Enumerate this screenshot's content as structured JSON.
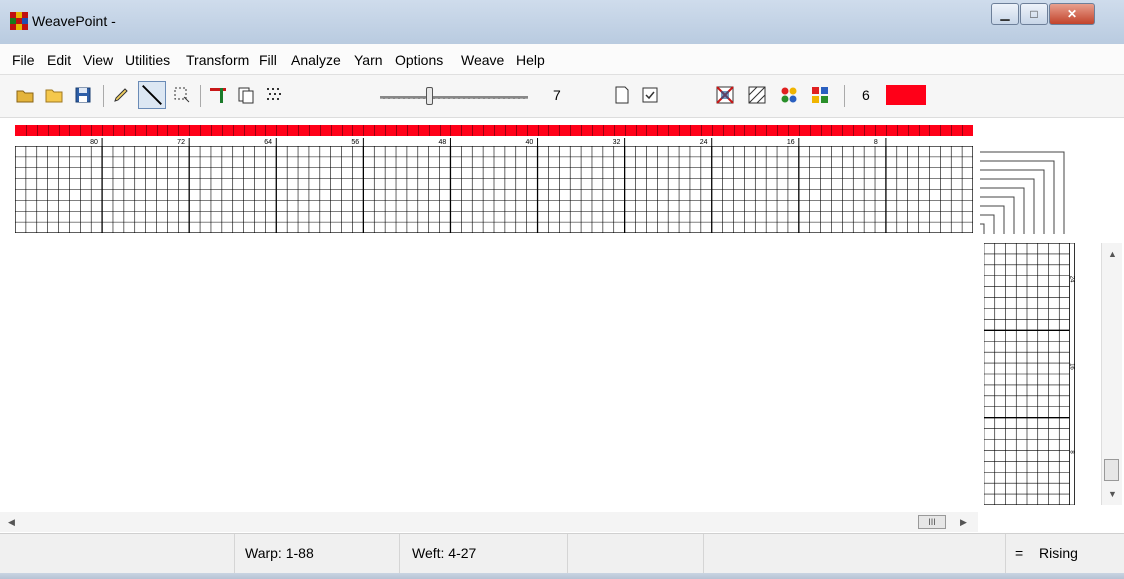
{
  "window": {
    "title": "WeavePoint -"
  },
  "menu": [
    "File",
    "Edit",
    "View",
    "Utilities",
    "Transform",
    "Fill",
    "Analyze",
    "Yarn",
    "Options",
    "Weave",
    "Help"
  ],
  "toolbar": {
    "slider_value": "7",
    "color_index": "6",
    "current_color": "#ff0018",
    "tools": [
      {
        "name": "open-icon"
      },
      {
        "name": "folder-icon"
      },
      {
        "name": "save-icon"
      },
      {
        "name": "pencil-tool-icon"
      },
      {
        "name": "line-tool-icon"
      },
      {
        "name": "select-tool-icon"
      },
      {
        "name": "threading-tool-icon"
      },
      {
        "name": "copy-icon"
      },
      {
        "name": "pattern-icon"
      },
      {
        "name": "new-page-icon"
      },
      {
        "name": "check-icon"
      },
      {
        "name": "weave-view-icon"
      },
      {
        "name": "drawdown-icon"
      },
      {
        "name": "yarn-colors-icon"
      },
      {
        "name": "palette-icon"
      }
    ]
  },
  "warp_ruler": {
    "labels": [
      "80",
      "72",
      "64",
      "56",
      "48",
      "40",
      "32",
      "24",
      "16",
      "8"
    ]
  },
  "treadling_ruler": {
    "labels": [
      "24",
      "16",
      "8"
    ]
  },
  "status": {
    "warp": "Warp: 1-88",
    "weft": "Weft: 4-27",
    "equals": "=",
    "mode": "Rising"
  },
  "scrollbars": {
    "h_thumb_glyph": "III"
  },
  "colors": {
    "warp_color": "#ff0018",
    "grid_line": "#000000"
  }
}
